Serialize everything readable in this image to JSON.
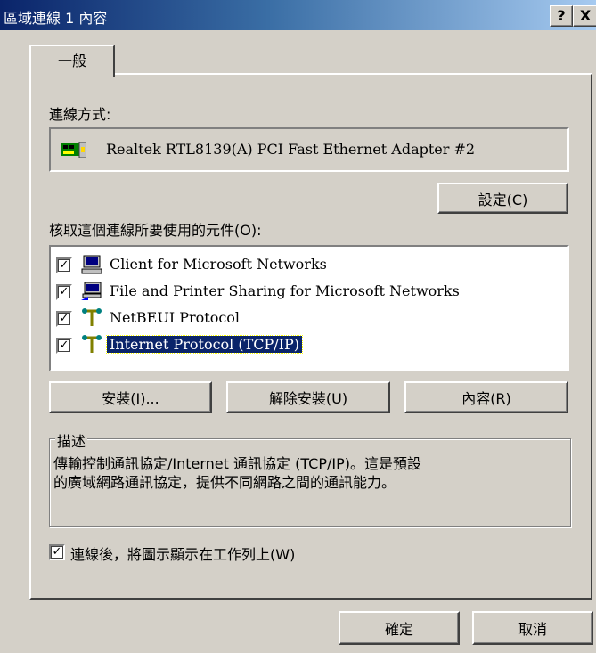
{
  "window": {
    "title": "區域連線 1 內容",
    "help_btn": "?",
    "close_btn": "X"
  },
  "tabs": [
    {
      "label": "一般",
      "active": true
    }
  ],
  "connect_using": {
    "label": "連線方式:",
    "adapter_icon": "network-card-icon",
    "adapter": "Realtek RTL8139(A) PCI Fast Ethernet Adapter #2",
    "configure_btn": "設定(C)"
  },
  "components": {
    "label": "核取這個連線所要使用的元件(O):",
    "items": [
      {
        "checked": true,
        "icon": "client-computer-icon",
        "label": "Client for Microsoft Networks",
        "selected": false
      },
      {
        "checked": true,
        "icon": "file-printer-sharing-icon",
        "label": "File and Printer Sharing for Microsoft Networks",
        "selected": false
      },
      {
        "checked": true,
        "icon": "protocol-icon",
        "label": "NetBEUI Protocol",
        "selected": false
      },
      {
        "checked": true,
        "icon": "protocol-icon",
        "label": "Internet Protocol (TCP/IP)",
        "selected": true
      }
    ],
    "install_btn": "安裝(I)...",
    "uninstall_btn": "解除安裝(U)",
    "properties_btn": "內容(R)"
  },
  "description": {
    "title": "描述",
    "line1": "傳輸控制通訊協定/Internet 通訊協定 (TCP/IP)。這是預設",
    "line2": "的廣域網路通訊協定，提供不同網路之間的通訊能力。"
  },
  "show_icon": {
    "checked": true,
    "label": "連線後，將圖示顯示在工作列上(W)"
  },
  "footer": {
    "ok_btn": "確定",
    "cancel_btn": "取消"
  }
}
